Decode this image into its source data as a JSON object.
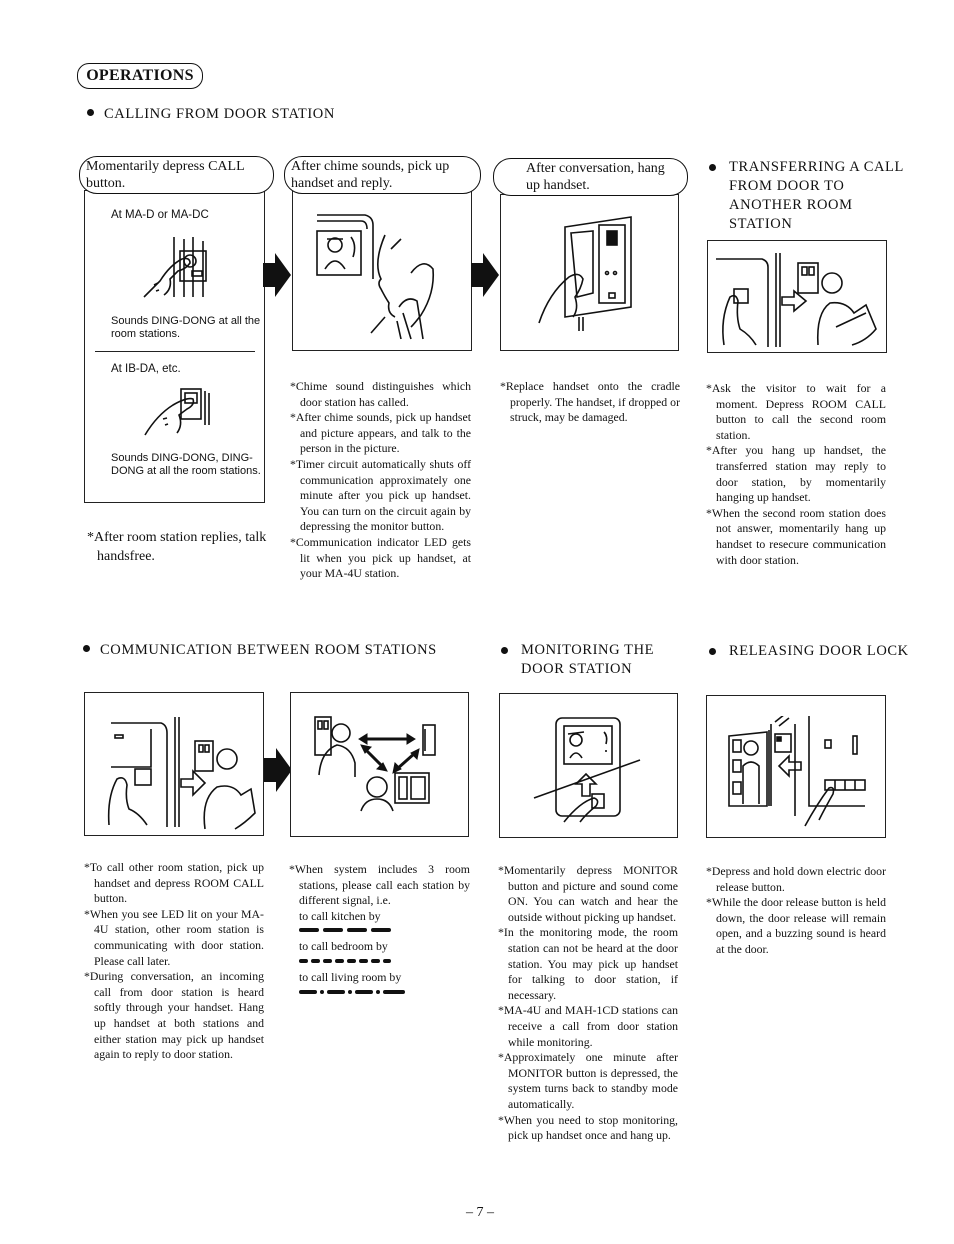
{
  "section_title": "OPERATIONS",
  "calling": {
    "heading": "CALLING FROM DOOR STATION",
    "step1": {
      "pill": "Momentarily depress CALL button.",
      "sub1_label": "At MA-D or MA-DC",
      "sub1_desc": "Sounds DING-DONG at all the room stations.",
      "sub2_label": "At IB-DA, etc.",
      "sub2_desc": "Sounds DING-DONG, DING-DONG at all the room stations.",
      "note": "After room station replies, talk handsfree."
    },
    "step2": {
      "pill": "After chime sounds, pick up handset and reply.",
      "notes": [
        "Chime sound distinguishes which door station has called.",
        "After chime sounds, pick up handset and picture appears, and talk to the person in the picture.",
        "Timer circuit automatically shuts off communication approximately one minute after you pick up handset. You can turn on the circuit again by depressing the monitor button.",
        "Communication indicator LED gets lit when you pick up handset, at your MA-4U station."
      ]
    },
    "step3": {
      "pill": "After conversation, hang up handset.",
      "notes": [
        "Replace handset onto the cradle properly. The handset, if dropped or struck, may be damaged."
      ]
    }
  },
  "transferring": {
    "heading": "TRANSFERRING A CALL FROM DOOR TO ANOTHER ROOM STATION",
    "notes": [
      "Ask the visitor to wait for a moment. Depress ROOM CALL button to call the second room station.",
      "After you hang up handset, the transferred station may reply to door station, by momentarily hanging up handset.",
      "When the second room station does not answer, momentarily hang up handset to resecure communication with door station."
    ]
  },
  "communication": {
    "heading": "COMMUNICATION BETWEEN ROOM STATIONS",
    "notes_left": [
      "To call other room station, pick up handset and depress ROOM CALL button.",
      "When you see LED lit on your MA-4U station, other room station is communicating with door station. Please call later.",
      "During conversation, an incoming call from door station is heard softly through your handset. Hang up handset at both stations and either station may pick up handset again to reply to door station."
    ],
    "notes_right_intro": "When system includes 3 room stations, please call each station by different signal, i.e.",
    "signals": [
      {
        "label": "to call kitchen by",
        "pattern": "long-long-long-long"
      },
      {
        "label": "to call bedroom by",
        "pattern": "short-x8"
      },
      {
        "label": "to call living room by",
        "pattern": "long-dot-long-dot-long-dot-long"
      }
    ]
  },
  "monitoring": {
    "heading": "MONITORING THE DOOR STATION",
    "notes": [
      "Momentarily depress MONITOR button and picture and sound come ON. You can watch and hear the outside without picking up handset.",
      "In the monitoring mode, the room station can not be heard at the door station. You may pick up handset for talking to door station, if necessary.",
      "MA-4U and MAH-1CD stations can receive a call from door station while monitoring.",
      "Approximately one minute after MONITOR button is depressed, the system turns back to standby mode automatically.",
      "When you need to stop monitoring, pick up handset once and hang up."
    ]
  },
  "releasing": {
    "heading": "RELEASING DOOR LOCK",
    "notes": [
      "Depress and hold down electric door release button.",
      "While the door release button is held down, the door release will remain open, and a buzzing sound is heard at the door."
    ]
  },
  "page_number": "– 7 –"
}
